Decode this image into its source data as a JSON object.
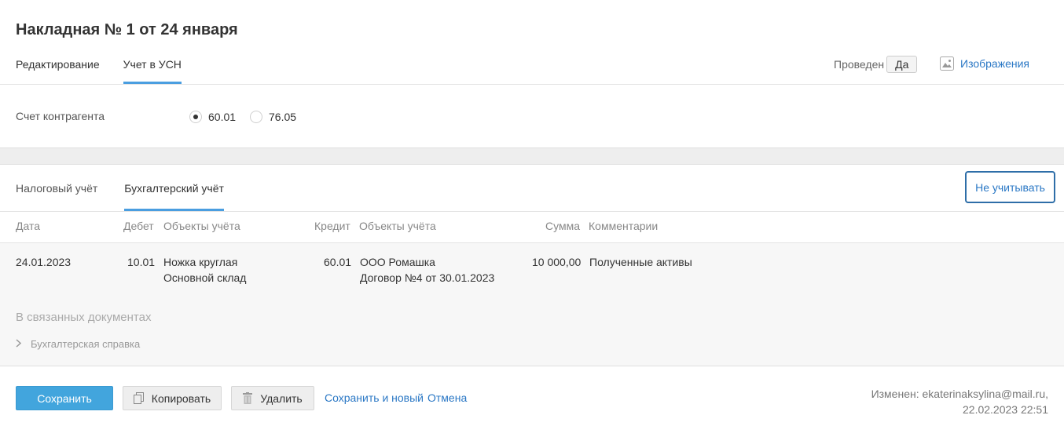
{
  "title": "Накладная № 1 от 24 января",
  "tabs": [
    "Редактирование",
    "Учет в УСН"
  ],
  "status": {
    "label": "Проведен",
    "value": "Да"
  },
  "images_link": "Изображения",
  "counterparty_account": {
    "label": "Счет контрагента",
    "options": [
      "60.01",
      "76.05"
    ],
    "selected": "60.01"
  },
  "subtabs": [
    "Налоговый учёт",
    "Бухгалтерский учёт"
  ],
  "ignore_button": "Не учитывать",
  "table": {
    "headers": [
      "Дата",
      "Дебет",
      "Объекты учёта",
      "Кредит",
      "Объекты учёта",
      "Сумма",
      "Комментарии"
    ],
    "rows": [
      {
        "date": "24.01.2023",
        "debit": "10.01",
        "debit_obj1": "Ножка круглая",
        "debit_obj2": "Основной склад",
        "credit": "60.01",
        "credit_obj1": "ООО Ромашка",
        "credit_obj2": "Договор №4 от 30.01.2023",
        "amount": "10 000,00",
        "comment": "Полученные активы"
      }
    ]
  },
  "linked_docs": {
    "title": "В связанных документах",
    "items": [
      "Бухгалтерская справка"
    ]
  },
  "footer": {
    "save": "Сохранить",
    "copy": "Копировать",
    "delete": "Удалить",
    "save_new": "Сохранить и новый",
    "cancel": "Отмена",
    "changed_line1": "Изменен: ekaterinaksylina@mail.ru,",
    "changed_line2": "22.02.2023 22:51"
  }
}
